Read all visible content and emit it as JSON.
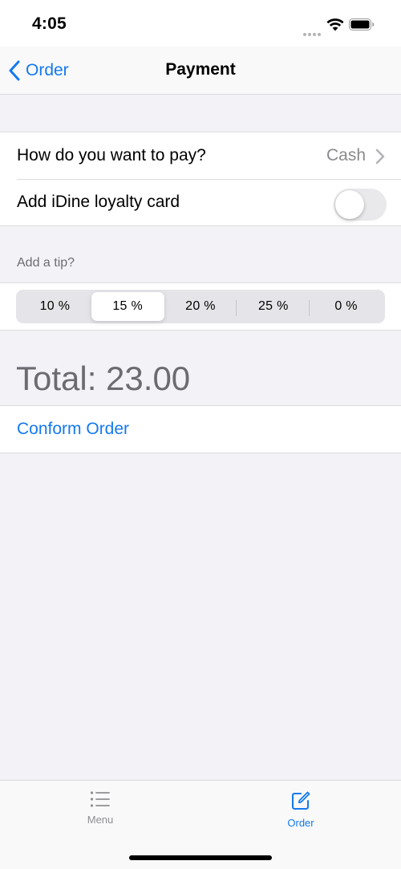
{
  "status_bar": {
    "time": "4:05"
  },
  "nav": {
    "back_label": "Order",
    "title": "Payment"
  },
  "payment_section": {
    "method_label": "How do you want to pay?",
    "method_value": "Cash",
    "loyalty_label": "Add iDine loyalty card",
    "loyalty_enabled": false
  },
  "tip_section": {
    "header": "Add a tip?",
    "options": [
      "10 %",
      "15 %",
      "20 %",
      "25 %",
      "0 %"
    ],
    "selected": "15 %"
  },
  "total_text": "Total: 23.00",
  "confirm_label": "Conform Order",
  "tab_bar": {
    "menu_label": "Menu",
    "order_label": "Order",
    "selected": "Order"
  },
  "colors": {
    "accent": "#1479f0",
    "background": "#f2f2f7",
    "secondary_text": "#8a8a8e"
  }
}
